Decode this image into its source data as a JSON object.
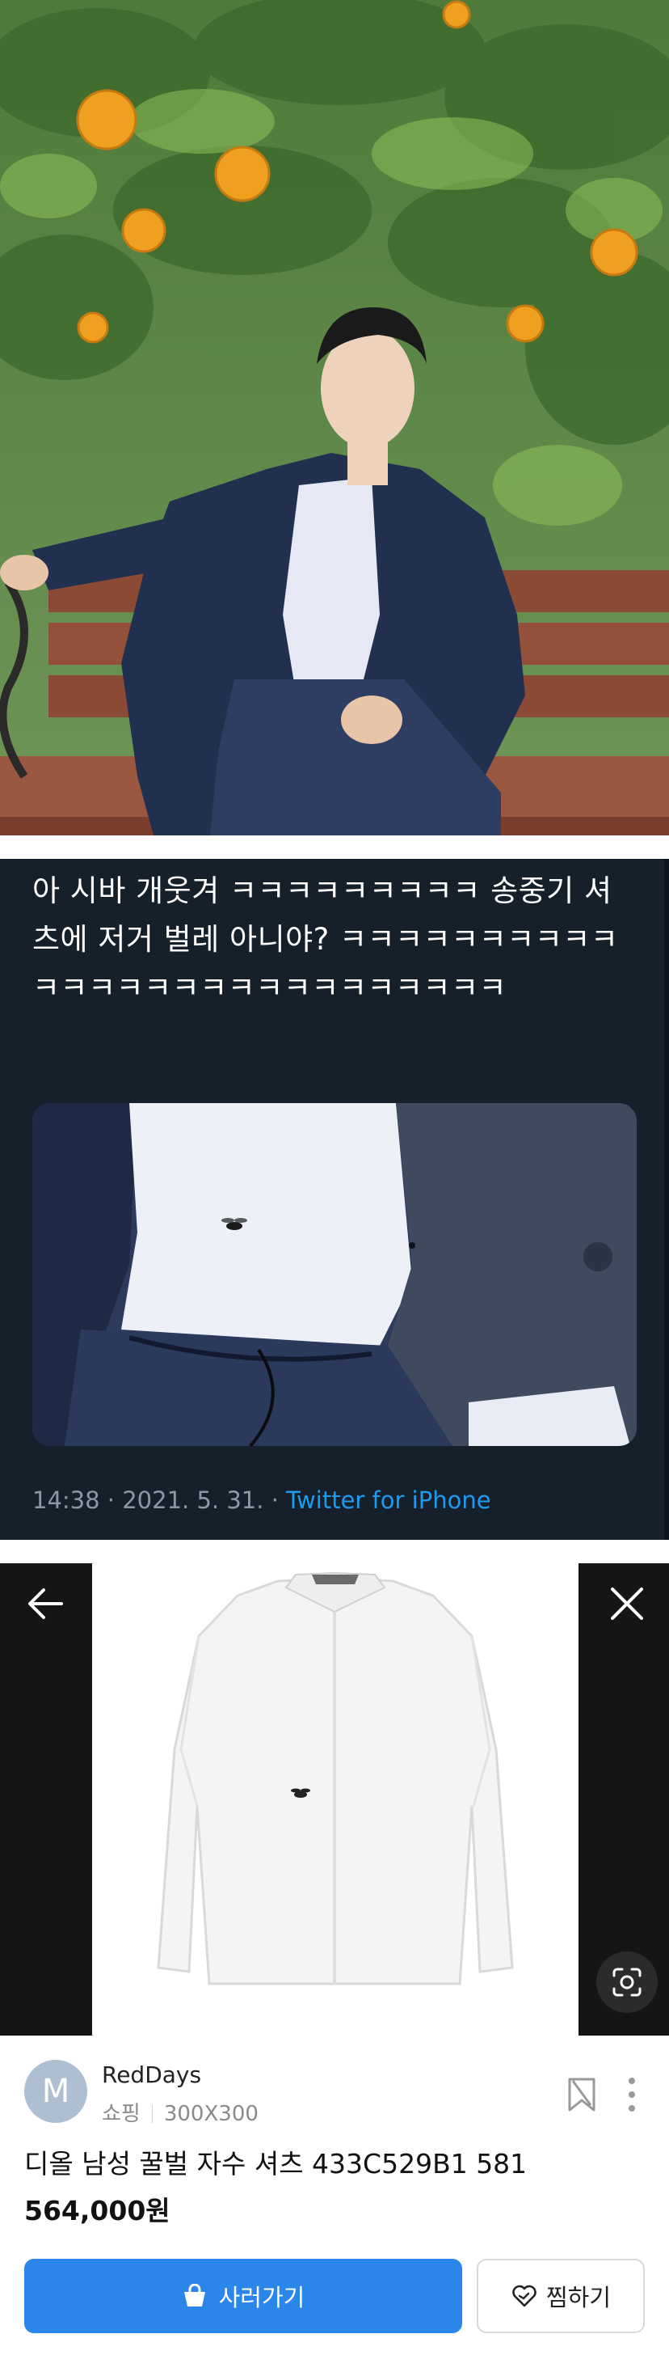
{
  "tweet": {
    "text": "아 시바 개웃겨 ㅋㅋㅋㅋㅋㅋㅋㅋㅋ 송중기 셔츠에 저거 벌레 아니야? ㅋㅋㅋㅋㅋㅋㅋㅋㅋㅋㅋㅋㅋㅋㅋㅋㅋㅋㅋㅋㅋㅋㅋㅋㅋㅋㅋ",
    "timestamp": "14:38 · 2021. 5. 31. · ",
    "source": "Twitter for iPhone"
  },
  "shopping": {
    "seller": {
      "avatar_letter": "M",
      "name": "RedDays",
      "category": "쇼핑",
      "image_size": "300X300"
    },
    "product": {
      "title": "디올 남성 꿀벌 자수 셔츠 433C529B1 581",
      "price": "564,000원"
    },
    "buy_label": "사러가기",
    "wish_label": "찜하기",
    "icons": {
      "back": "arrow-left-icon",
      "close": "close-icon",
      "lens": "lens-search-icon",
      "bookmark": "bookmark-icon",
      "more": "more-vertical-icon",
      "buy": "shopping-bag-icon",
      "wish": "heart-icon"
    },
    "colors": {
      "buy_button": "#2a86e8",
      "tweet_background": "#15202b",
      "link": "#1d9bf0"
    }
  }
}
